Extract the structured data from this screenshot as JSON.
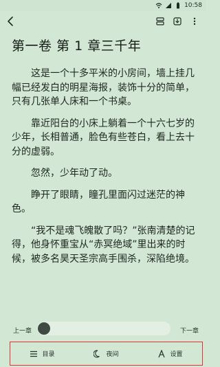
{
  "status_bar": {
    "time": "10:58",
    "icons": [
      "wifi-icon",
      "signal-icon",
      "battery-icon"
    ]
  },
  "toolbar": {
    "back_icon": "chevron-left-icon",
    "actions": [
      "layout-icon",
      "download-icon",
      "more-vertical-icon"
    ]
  },
  "chapter": {
    "title": "第一卷 第 1 章三千年",
    "paragraphs": [
      "这是一个十多平米的小房间，墙上挂几幅已经发白的明星海报，装饰十分的简单，只有几张单人床和一个书桌。",
      "靠近阳台的小床上躺着一个十六七岁的少年，长相普通，脸色有些苍白，看上去十分的虚弱。",
      "忽然，少年动了动。",
      "睁开了眼睛，瞳孔里面闪过迷茫的神色。",
      "“我不是魂飞魄散了吗？”张南清楚的记得，他身怀重宝从“赤冥绝域”里出来的时候，被多名昊天圣宗高手围杀，深陷绝境。"
    ]
  },
  "progress": {
    "prev_label": "上一章",
    "next_label": "下一章",
    "value": 0
  },
  "bottom_menu": [
    {
      "label": "目录",
      "icon": "list-icon"
    },
    {
      "label": "夜间",
      "icon": "moon-icon"
    },
    {
      "label": "设置",
      "icon": "font-settings-icon"
    }
  ],
  "colors": {
    "background": "#d2e7d4",
    "highlight_border": "#e4312f"
  }
}
